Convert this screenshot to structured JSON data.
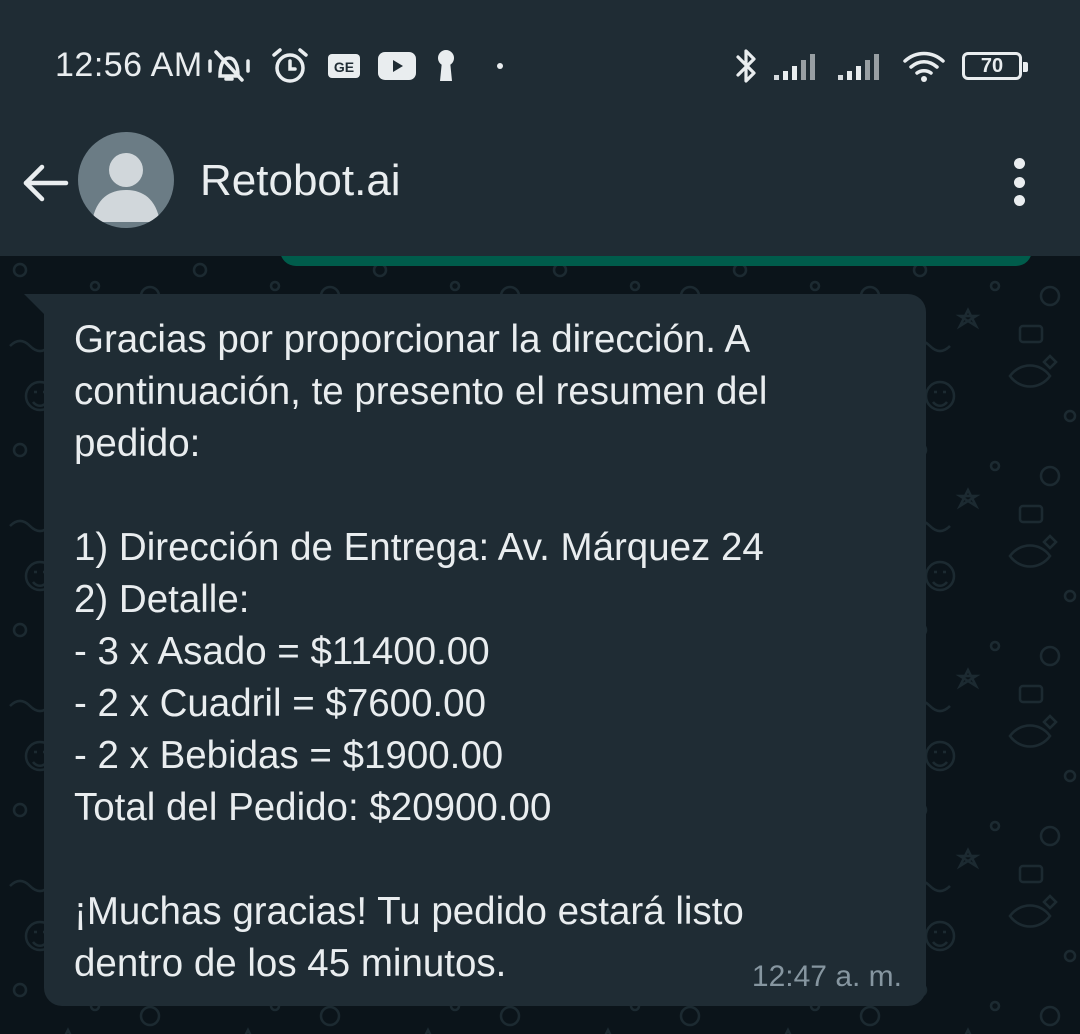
{
  "status_bar": {
    "time": "12:56 AM",
    "battery_level": "70",
    "icons_left": [
      "vibrate-off-icon",
      "alarm-icon",
      "gmail-icon",
      "youtube-icon",
      "keyhole-icon",
      "dot-icon"
    ],
    "icons_right": [
      "bluetooth-icon",
      "signal-icon",
      "signal-icon",
      "wifi-icon",
      "battery-icon"
    ]
  },
  "header": {
    "contact_name": "Retobot.ai",
    "back_icon": "arrow-left-icon",
    "menu_icon": "more-vertical-icon"
  },
  "messages": [
    {
      "direction": "incoming",
      "text": "Gracias por proporcionar la dirección. A\ncontinuación, te presento el resumen del\npedido:\n\n1) Dirección de Entrega: Av. Márquez 24\n2) Detalle:\n- 3 x Asado = $11400.00\n- 2 x Cuadril = $7600.00\n- 2 x Bebidas = $1900.00\nTotal del Pedido: $20900.00\n\n¡Muchas gracias! Tu pedido estará listo\ndentro de los 45 minutos.",
      "time": "12:47 a. m."
    }
  ],
  "colors": {
    "header_bg": "#1f2c34",
    "chat_bg": "#0b141a",
    "incoming_bubble": "#1f2c34",
    "outgoing_bubble": "#005c4b",
    "text": "#e9edef",
    "meta_text": "#8696a0"
  }
}
